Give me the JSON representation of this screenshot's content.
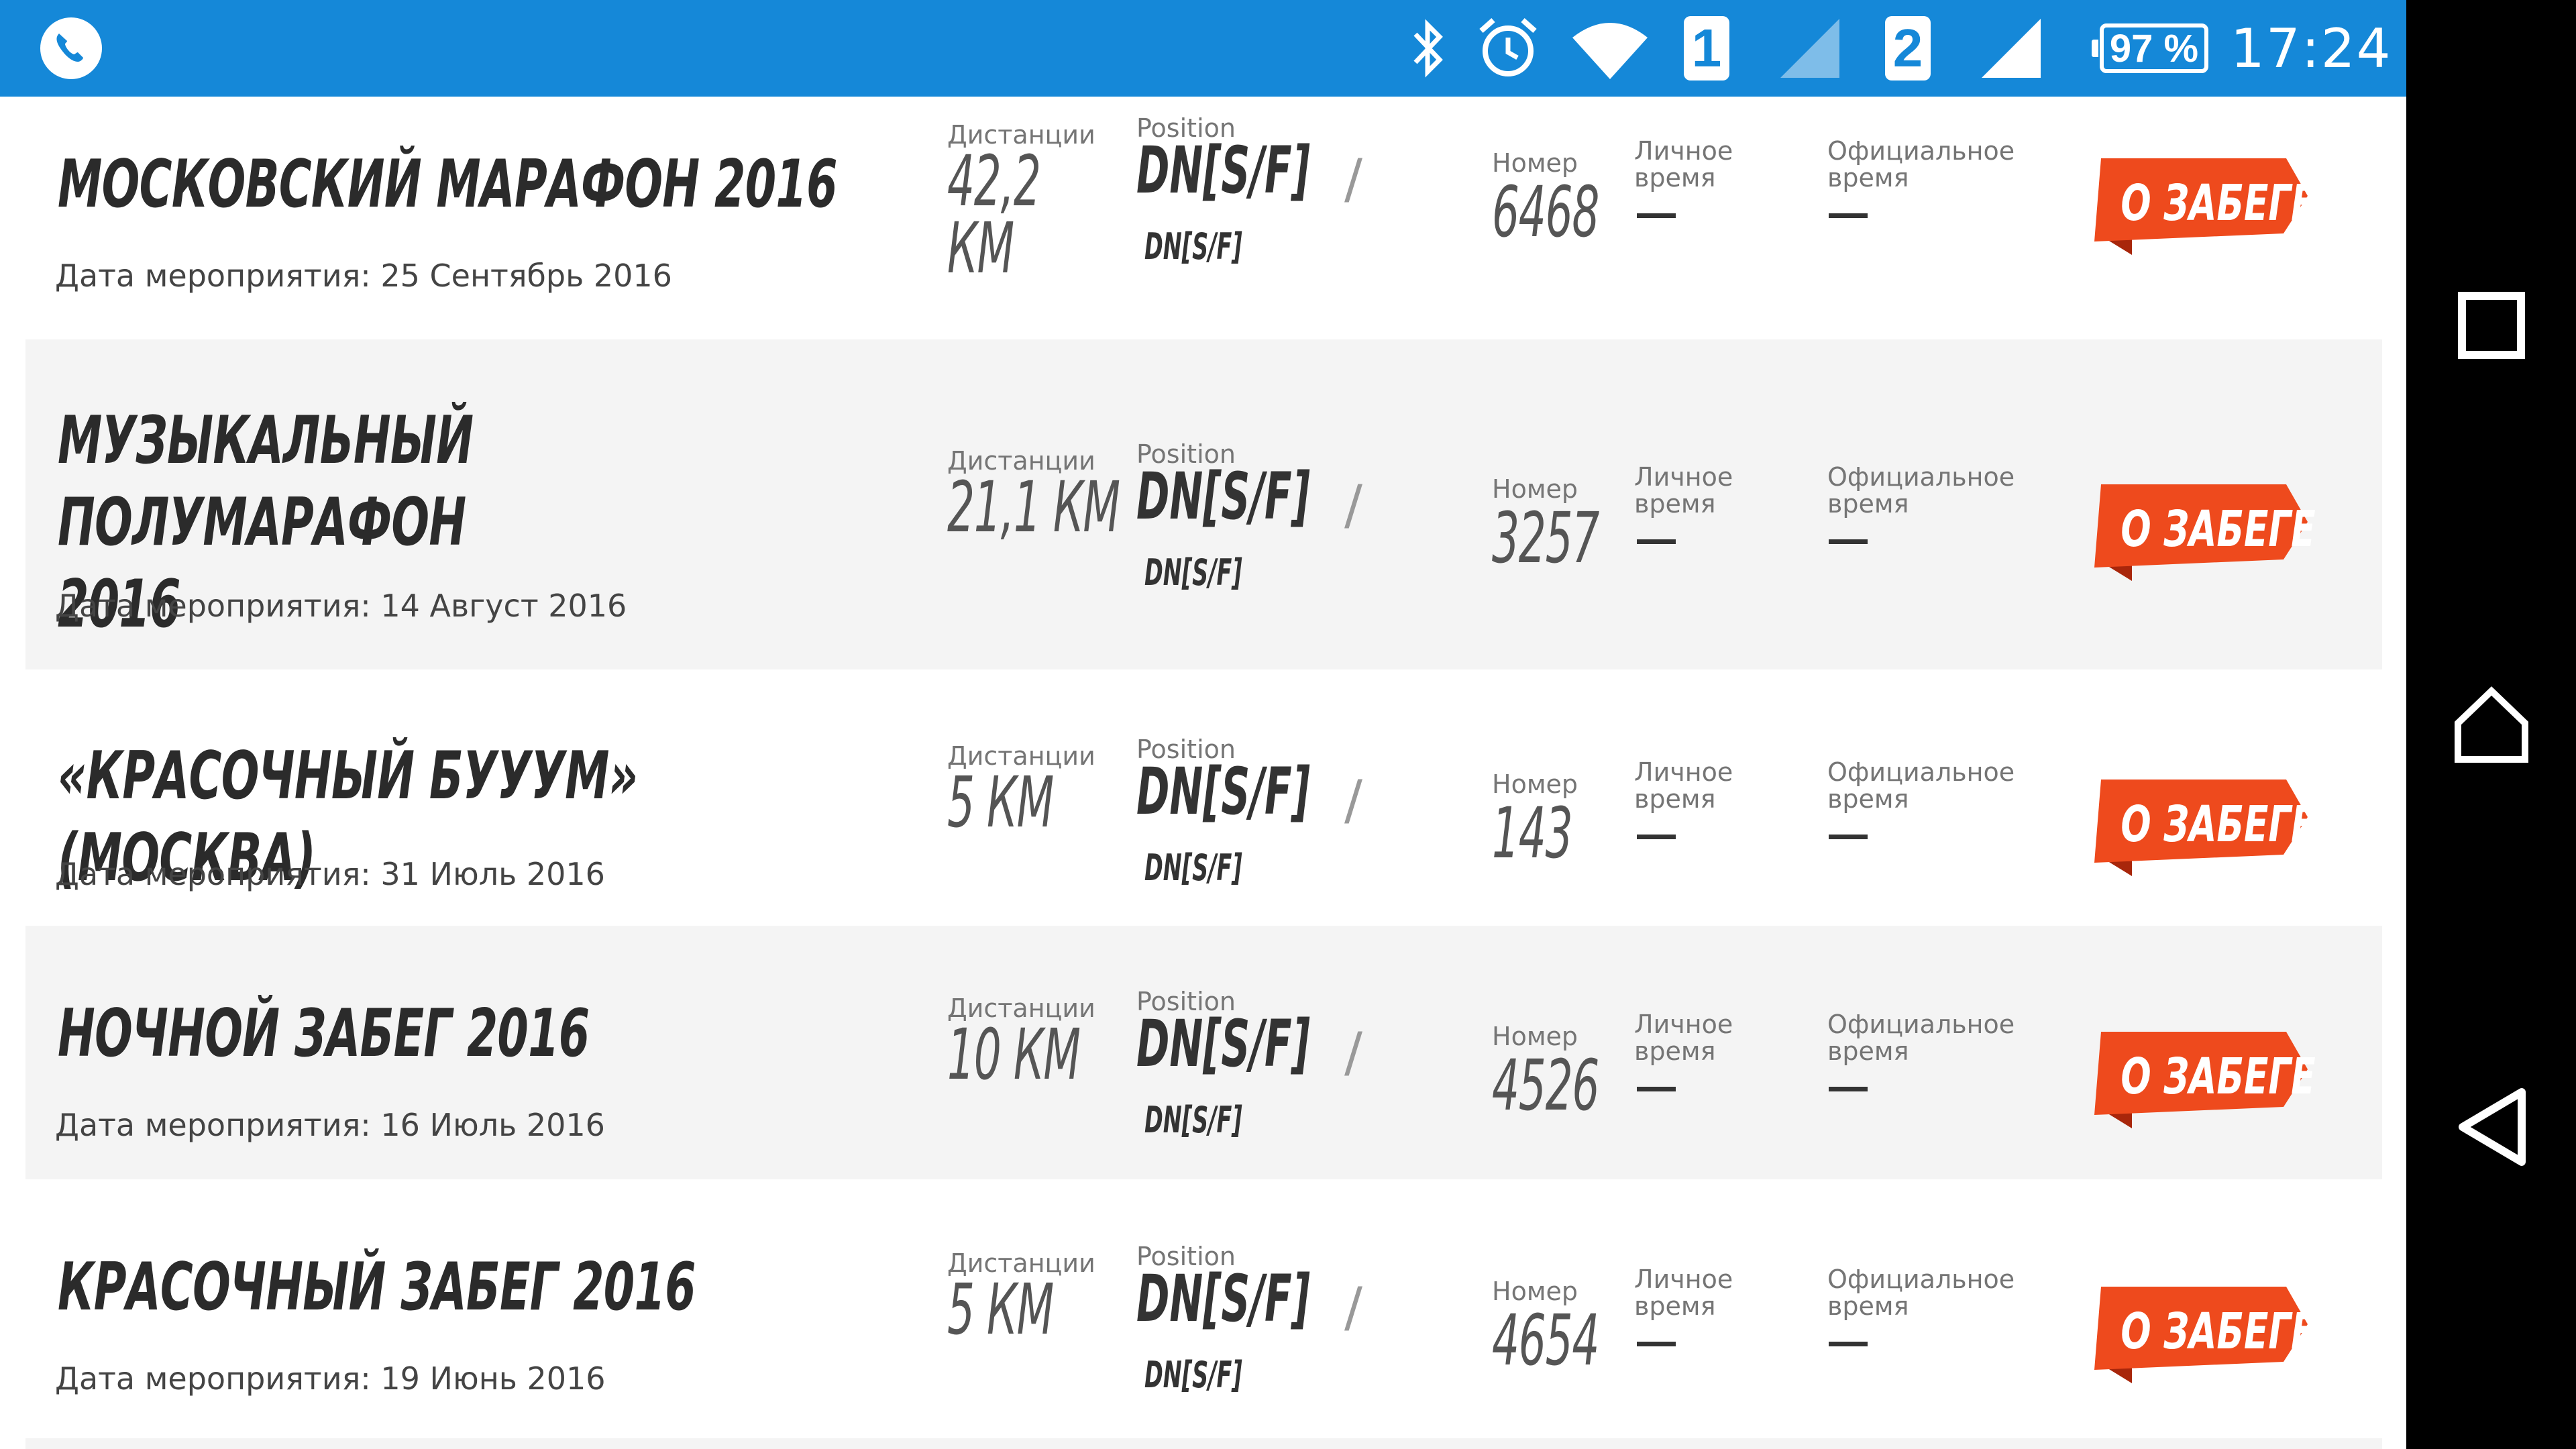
{
  "status_bar": {
    "sim1": "1",
    "sim2": "2",
    "battery": "97 %",
    "time": "17:24",
    "icons": [
      "phone-icon",
      "bluetooth-icon",
      "alarm-icon",
      "wifi-icon",
      "signal-icon"
    ],
    "colors": {
      "background": "#1588d8",
      "foreground": "#ffffff"
    }
  },
  "labels": {
    "distance": "Дистанции",
    "position": "Position",
    "number": "Номер",
    "personal_time_1": "Личное",
    "personal_time_2": "время",
    "official_time_1": "Официальное",
    "official_time_2": "время",
    "position_value": "DN[S/F]",
    "position_sub": "DN[S/F]",
    "slash": "/",
    "button": "О ЗАБЕГЕ"
  },
  "races": [
    {
      "name_lines": [
        "МОСКОВСКИЙ МАРАФОН 2016"
      ],
      "date": "Дата мероприятия: 25 Сентябрь 2016",
      "distance_lines": [
        "42,2",
        "КМ"
      ],
      "number": "6468"
    },
    {
      "name_lines": [
        "МУЗЫКАЛЬНЫЙ ПОЛУМАРАФОН",
        "2016"
      ],
      "date": "Дата мероприятия: 14 Август 2016",
      "distance_lines": [
        "21,1 КМ"
      ],
      "number": "3257"
    },
    {
      "name_lines": [
        "«КРАСОЧНЫЙ БУУУМ» (МОСКВА)"
      ],
      "date": "Дата мероприятия: 31 Июль 2016",
      "distance_lines": [
        "5 КМ"
      ],
      "number": "143"
    },
    {
      "name_lines": [
        "НОЧНОЙ ЗАБЕГ 2016"
      ],
      "date": "Дата мероприятия: 16 Июль 2016",
      "distance_lines": [
        "10 КМ"
      ],
      "number": "4526"
    },
    {
      "name_lines": [
        "КРАСОЧНЫЙ ЗАБЕГ 2016"
      ],
      "date": "Дата мероприятия: 19 Июнь 2016",
      "distance_lines": [
        "5 КМ"
      ],
      "number": "4654"
    }
  ],
  "colors": {
    "button": "#ee4a1d",
    "button_fold": "#a8260b",
    "row_shade": "#f4f4f4"
  }
}
